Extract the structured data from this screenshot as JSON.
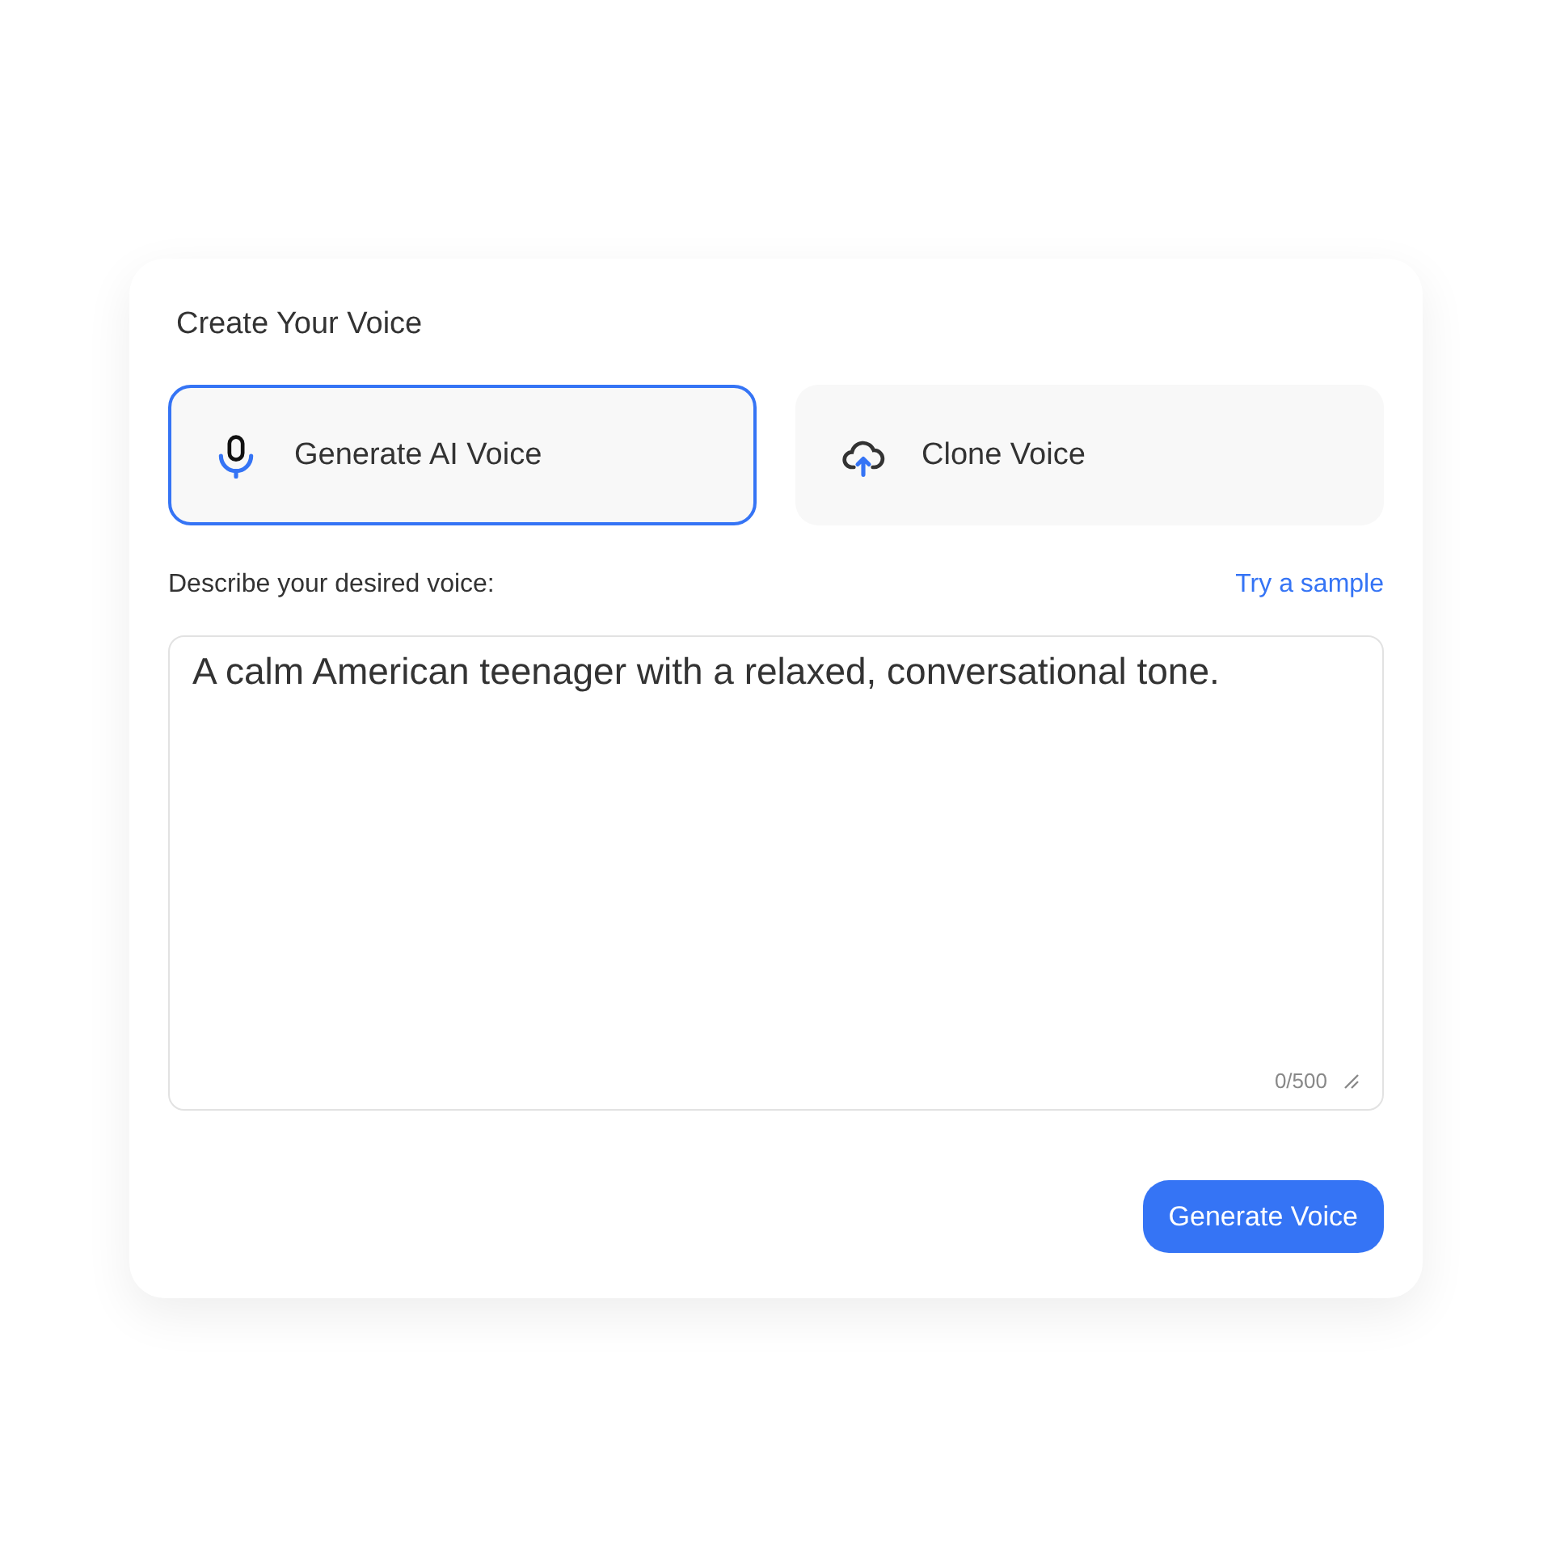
{
  "title": "Create Your Voice",
  "options": [
    {
      "kind": "mic",
      "label": "Generate AI Voice",
      "selected": true
    },
    {
      "kind": "cloud",
      "label": "Clone Voice",
      "selected": false
    }
  ],
  "prompt": {
    "label": "Describe your desired voice:",
    "link": "Try a sample",
    "value": "A calm American teenager with a relaxed, conversational tone.",
    "counter": "0/500"
  },
  "submit": "Generate Voice"
}
